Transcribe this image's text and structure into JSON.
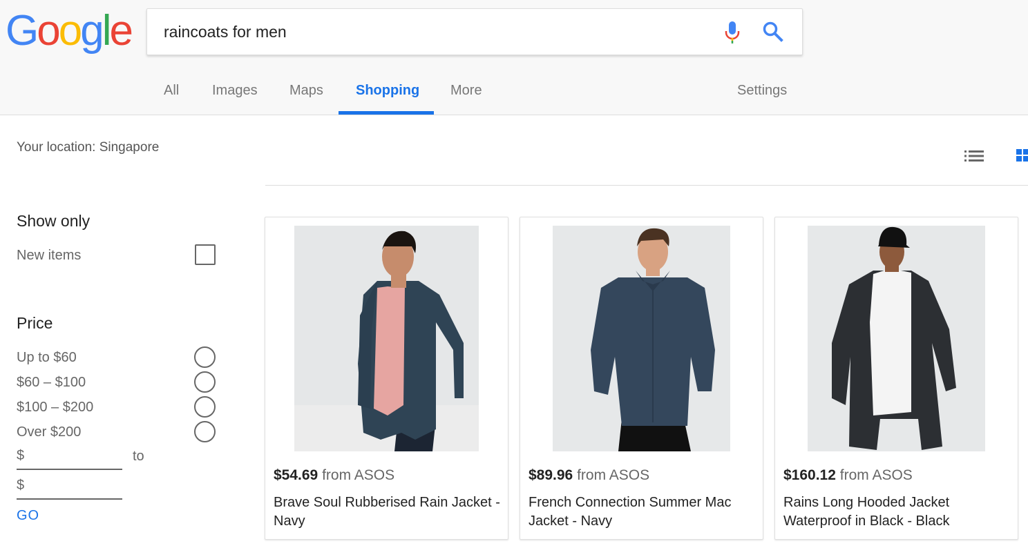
{
  "logo": {
    "letters": [
      "G",
      "o",
      "o",
      "g",
      "l",
      "e"
    ],
    "colors": [
      "#4285F4",
      "#EA4335",
      "#FBBC05",
      "#4285F4",
      "#34A853",
      "#EA4335"
    ]
  },
  "search": {
    "query": "raincoats for men"
  },
  "tabs": [
    {
      "label": "All"
    },
    {
      "label": "Images"
    },
    {
      "label": "Maps"
    },
    {
      "label": "Shopping"
    },
    {
      "label": "More"
    },
    {
      "label": "Settings"
    }
  ],
  "location": "Your location: Singapore",
  "filters": {
    "show_only_title": "Show only",
    "new_items_label": "New items",
    "price_title": "Price",
    "price_options": [
      "Up to $60",
      "$60 – $100",
      "$100 – $200",
      "Over $200"
    ],
    "currency_symbol": "$",
    "to_label": "to",
    "go_label": "GO"
  },
  "products": [
    {
      "price": "$54.69",
      "from": "from ASOS",
      "name": "Brave Soul Rubberised Rain Jacket - Navy"
    },
    {
      "price": "$89.96",
      "from": "from ASOS",
      "name": "French Connection Summer Mac Jacket - Navy"
    },
    {
      "price": "$160.12",
      "from": "from ASOS",
      "name": "Rains Long Hooded Jacket Waterproof in Black - Black"
    }
  ],
  "colors": {
    "accent": "#1a73e8",
    "header_bg": "#f8f8f8"
  }
}
